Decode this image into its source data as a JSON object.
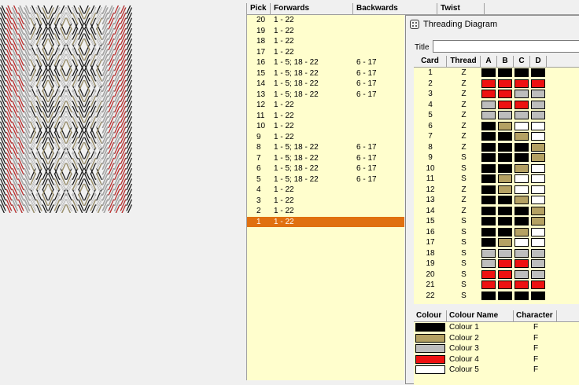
{
  "palette": {
    "colour1": "#000000",
    "colour2": "#b4a163",
    "colour3": "#bdbdbd",
    "colour4": "#ee1111",
    "colour5": "#ffffff"
  },
  "pick_table": {
    "headers": {
      "pick": "Pick",
      "forwards": "Forwards",
      "backwards": "Backwards",
      "twist": "Twist"
    },
    "selected_pick": "1",
    "rows": [
      {
        "pick": "20",
        "forwards": "1 - 22",
        "backwards": ""
      },
      {
        "pick": "19",
        "forwards": "1 - 22",
        "backwards": ""
      },
      {
        "pick": "18",
        "forwards": "1 - 22",
        "backwards": ""
      },
      {
        "pick": "17",
        "forwards": "1 - 22",
        "backwards": ""
      },
      {
        "pick": "16",
        "forwards": "1 - 5; 18 - 22",
        "backwards": "6 - 17"
      },
      {
        "pick": "15",
        "forwards": "1 - 5; 18 - 22",
        "backwards": "6 - 17"
      },
      {
        "pick": "14",
        "forwards": "1 - 5; 18 - 22",
        "backwards": "6 - 17"
      },
      {
        "pick": "13",
        "forwards": "1 - 5; 18 - 22",
        "backwards": "6 - 17"
      },
      {
        "pick": "12",
        "forwards": "1 - 22",
        "backwards": ""
      },
      {
        "pick": "11",
        "forwards": "1 - 22",
        "backwards": ""
      },
      {
        "pick": "10",
        "forwards": "1 - 22",
        "backwards": ""
      },
      {
        "pick": "9",
        "forwards": "1 - 22",
        "backwards": ""
      },
      {
        "pick": "8",
        "forwards": "1 - 5; 18 - 22",
        "backwards": "6 - 17"
      },
      {
        "pick": "7",
        "forwards": "1 - 5; 18 - 22",
        "backwards": "6 - 17"
      },
      {
        "pick": "6",
        "forwards": "1 - 5; 18 - 22",
        "backwards": "6 - 17"
      },
      {
        "pick": "5",
        "forwards": "1 - 5; 18 - 22",
        "backwards": "6 - 17"
      },
      {
        "pick": "4",
        "forwards": "1 - 22",
        "backwards": ""
      },
      {
        "pick": "3",
        "forwards": "1 - 22",
        "backwards": ""
      },
      {
        "pick": "2",
        "forwards": "1 - 22",
        "backwards": ""
      },
      {
        "pick": "1",
        "forwards": "1 - 22",
        "backwards": ""
      }
    ]
  },
  "threading_window": {
    "title": "Threading Diagram",
    "title_field_label": "Title",
    "title_field_value": "",
    "title_icon": "dice-icon",
    "card_headers": {
      "card": "Card",
      "thread": "Thread",
      "a": "A",
      "b": "B",
      "c": "C",
      "d": "D"
    },
    "cards": [
      {
        "card": "1",
        "thread": "Z",
        "holes": [
          "colour1",
          "colour1",
          "colour1",
          "colour1"
        ]
      },
      {
        "card": "2",
        "thread": "Z",
        "holes": [
          "colour4",
          "colour4",
          "colour4",
          "colour4"
        ]
      },
      {
        "card": "3",
        "thread": "Z",
        "holes": [
          "colour4",
          "colour4",
          "colour3",
          "colour3"
        ]
      },
      {
        "card": "4",
        "thread": "Z",
        "holes": [
          "colour3",
          "colour4",
          "colour4",
          "colour3"
        ]
      },
      {
        "card": "5",
        "thread": "Z",
        "holes": [
          "colour3",
          "colour3",
          "colour3",
          "colour3"
        ]
      },
      {
        "card": "6",
        "thread": "Z",
        "holes": [
          "colour1",
          "colour2",
          "colour5",
          "colour5"
        ]
      },
      {
        "card": "7",
        "thread": "Z",
        "holes": [
          "colour1",
          "colour1",
          "colour2",
          "colour5"
        ]
      },
      {
        "card": "8",
        "thread": "Z",
        "holes": [
          "colour1",
          "colour1",
          "colour1",
          "colour2"
        ]
      },
      {
        "card": "9",
        "thread": "S",
        "holes": [
          "colour1",
          "colour1",
          "colour1",
          "colour2"
        ]
      },
      {
        "card": "10",
        "thread": "S",
        "holes": [
          "colour1",
          "colour1",
          "colour2",
          "colour5"
        ]
      },
      {
        "card": "11",
        "thread": "S",
        "holes": [
          "colour1",
          "colour2",
          "colour5",
          "colour5"
        ]
      },
      {
        "card": "12",
        "thread": "Z",
        "holes": [
          "colour1",
          "colour2",
          "colour5",
          "colour5"
        ]
      },
      {
        "card": "13",
        "thread": "Z",
        "holes": [
          "colour1",
          "colour1",
          "colour2",
          "colour5"
        ]
      },
      {
        "card": "14",
        "thread": "Z",
        "holes": [
          "colour1",
          "colour1",
          "colour1",
          "colour2"
        ]
      },
      {
        "card": "15",
        "thread": "S",
        "holes": [
          "colour1",
          "colour1",
          "colour1",
          "colour2"
        ]
      },
      {
        "card": "16",
        "thread": "S",
        "holes": [
          "colour1",
          "colour1",
          "colour2",
          "colour5"
        ]
      },
      {
        "card": "17",
        "thread": "S",
        "holes": [
          "colour1",
          "colour2",
          "colour5",
          "colour5"
        ]
      },
      {
        "card": "18",
        "thread": "S",
        "holes": [
          "colour3",
          "colour3",
          "colour3",
          "colour3"
        ]
      },
      {
        "card": "19",
        "thread": "S",
        "holes": [
          "colour3",
          "colour4",
          "colour4",
          "colour3"
        ]
      },
      {
        "card": "20",
        "thread": "S",
        "holes": [
          "colour4",
          "colour4",
          "colour3",
          "colour3"
        ]
      },
      {
        "card": "21",
        "thread": "S",
        "holes": [
          "colour4",
          "colour4",
          "colour4",
          "colour4"
        ]
      },
      {
        "card": "22",
        "thread": "S",
        "holes": [
          "colour1",
          "colour1",
          "colour1",
          "colour1"
        ]
      }
    ],
    "colour_headers": {
      "colour": "Colour",
      "name": "Colour Name",
      "character": "Character"
    },
    "colours": [
      {
        "key": "colour1",
        "name": "Colour 1",
        "character": "F"
      },
      {
        "key": "colour2",
        "name": "Colour 2",
        "character": "F"
      },
      {
        "key": "colour3",
        "name": "Colour 3",
        "character": "F"
      },
      {
        "key": "colour4",
        "name": "Colour 4",
        "character": "F"
      },
      {
        "key": "colour5",
        "name": "Colour 5",
        "character": "F"
      }
    ]
  }
}
